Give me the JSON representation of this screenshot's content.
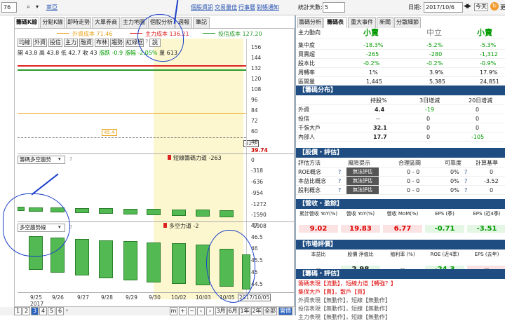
{
  "top": {
    "code": "76",
    "name": "萊亞",
    "links": [
      "個股資訊",
      "交易量佳",
      "行事曆",
      "對帳通知"
    ],
    "days_label": "統計天數:",
    "days": "5",
    "date_label": "日期:",
    "date": "2017/10/6",
    "today": "今天",
    "update": "更"
  },
  "tabs": [
    "籌碼K線",
    "分點K線",
    "即時走勢",
    "大單券商",
    "主力地圖",
    "個股分析",
    "週報",
    "筆記"
  ],
  "legend": [
    {
      "label": "外資成本 71.46",
      "color": "#e8a21a"
    },
    {
      "label": "主力成本 136.21",
      "color": "#d22"
    },
    {
      "label": "投信成本 127.20",
      "color": "#2a9a2a"
    }
  ],
  "toolbar": [
    "均線",
    "外資",
    "投信",
    "主力",
    "融資",
    "布林",
    "趨勢",
    "紅綠框"
  ],
  "toolbar_extra": "說",
  "ohlc": {
    "open": "開 43.8",
    "high": "高 43.8",
    "low": "低 42.7",
    "close": "收 43",
    "chg": "漲跌 -0.9",
    "pct": "漲幅 -2.05%",
    "vol": "量 613"
  },
  "price_axis": [
    "156",
    "144",
    "132",
    "120",
    "108",
    "96",
    "84",
    "72",
    "60",
    "48"
  ],
  "price_last": "39.74",
  "price_marks": {
    "m1": "45.4",
    "m2": "42.7"
  },
  "p2": {
    "select": "籌碼多空趨勢",
    "q": "?",
    "note": "短線籌碼力道 -263",
    "axis": [
      "0",
      "-318",
      "-636",
      "-954",
      "-1272",
      "-1590",
      "-1908"
    ]
  },
  "p3": {
    "select": "多空趨勢線",
    "q": "?",
    "note": "多空力道 -2",
    "axis": [
      "47",
      "46.5",
      "46",
      "45.5",
      "45",
      "44.5"
    ]
  },
  "xaxis": [
    "9/25\n2017",
    "9/26",
    "9/27",
    "9/28",
    "9/29",
    "9/30",
    "10/02",
    "10/03",
    "10/05",
    "2017/10/05"
  ],
  "pages": [
    "1",
    "2",
    "3",
    "4",
    "5",
    "6"
  ],
  "periods": [
    "3月",
    "6月",
    "1年",
    "2年",
    "全部",
    "實價"
  ],
  "right_tabs": [
    "籌碼分析",
    "籌碼表",
    "重大事件",
    "新聞",
    "分散細節"
  ],
  "summary": {
    "cols": [
      "小賣",
      "中立",
      "小賣"
    ],
    "rows": [
      [
        "集中度",
        "-18.3%",
        "-5.2%",
        "-5.3%"
      ],
      [
        "買賣超",
        "-265",
        "-280",
        "-1,312"
      ],
      [
        "股本比",
        "-0.2%",
        "-0.2%",
        "-0.9%"
      ],
      [
        "周轉率",
        "1%",
        "3.9%",
        "17.9%"
      ],
      [
        "區間量",
        "1,445",
        "5,385",
        "24,851"
      ]
    ],
    "head": "主力動向"
  },
  "dist": {
    "title": "【籌碼分布】",
    "cols": [
      "持股%",
      "3日增減",
      "20日增減"
    ],
    "rows": [
      [
        "外資",
        "4.4",
        "-19",
        "0"
      ],
      [
        "投信",
        "--",
        "0",
        "0"
      ],
      [
        "千張大戶",
        "32.1",
        "0",
        "0"
      ],
      [
        "內部人",
        "17.7",
        "0",
        "-105"
      ]
    ]
  },
  "val": {
    "title": "【股價・評估】",
    "cols": [
      "評估方法",
      "風險提示",
      "合理區間",
      "可靠度",
      "計算基準"
    ],
    "rows": [
      [
        "ROE概念",
        "無法評估",
        "0 - 0",
        "0%",
        "0"
      ],
      [
        "本益比概念",
        "無法評估",
        "0 - 0",
        "0%",
        "-3.52"
      ],
      [
        "股利概念",
        "無法評估",
        "0 - 0",
        "0%",
        "0"
      ]
    ]
  },
  "rev": {
    "title": "【營收・盈餘】",
    "cols": [
      "累計營收 YoY(%)",
      "營收 YoY(%)",
      "營收 MoM(%)",
      "EPS (季)",
      "EPS (近4季)"
    ],
    "vals": [
      "9.02",
      "19.83",
      "6.77",
      "-0.71",
      "-3.51"
    ]
  },
  "mkt": {
    "title": "【市場評價】",
    "cols": [
      "本益比",
      "股價 淨值比",
      "殖利率 (%)",
      "ROE (近4季)",
      "EPS (去年)"
    ],
    "vals": [
      "--",
      "2.98",
      "--",
      "-24.3",
      "--"
    ]
  },
  "chip": {
    "title": "【籌碼・評估】",
    "lines": [
      "籌碼表現【流動】，短線力道【轉強？】",
      "集保大戶【賣】，散戶【買】",
      "外資表現【無動作】，短線【無動作】",
      "投信表現【無動作】，短線【無動作】",
      "主力表現【無動作】，短線【無動作】"
    ]
  }
}
